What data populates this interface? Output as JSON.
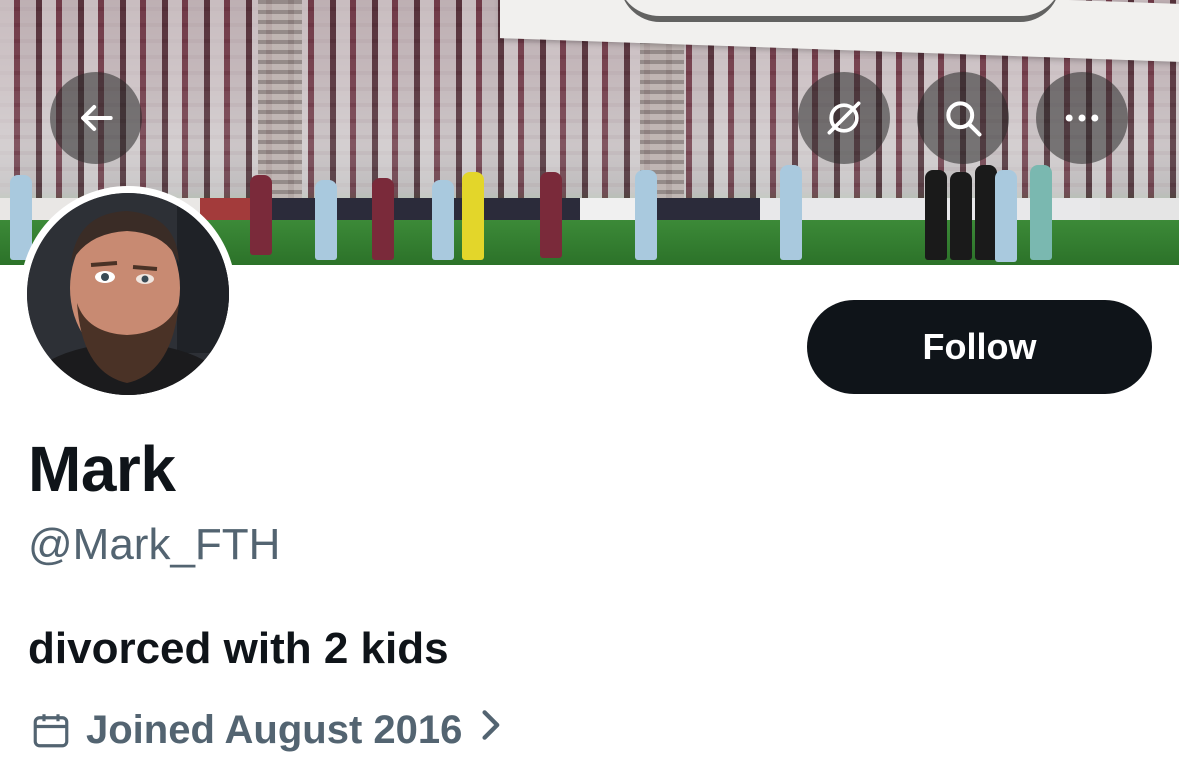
{
  "banner": {
    "description_icons": [
      "back-arrow-icon",
      "privacy-eye-slash-icon",
      "search-icon",
      "more-options-icon"
    ]
  },
  "profile": {
    "name": "Mark",
    "handle": "@Mark_FTH",
    "bio": "divorced with 2 kids",
    "joined": "Joined August 2016"
  },
  "actions": {
    "follow_label": "Follow"
  },
  "colors": {
    "primary_text": "#0f1419",
    "secondary_text": "#536471",
    "button_bg": "#0f1419",
    "button_text": "#ffffff"
  }
}
